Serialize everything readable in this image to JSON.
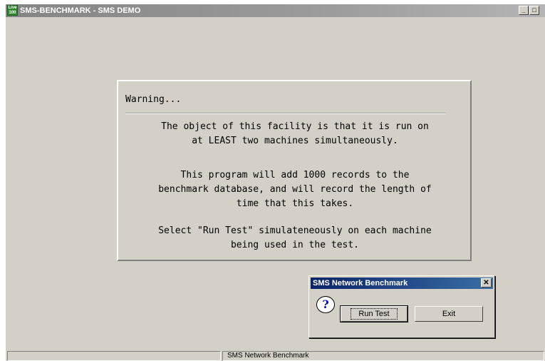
{
  "window": {
    "icon_text": "Live 100",
    "title": "SMS-BENCHMARK - SMS DEMO",
    "minimize_label": "_",
    "maximize_label": "□"
  },
  "warning": {
    "heading": "Warning...",
    "paragraphs": [
      "The object of this facility is that it is run on\nat LEAST two machines simultaneously.",
      "This program will add 1000 records to the\nbenchmark database, and will record the length of\ntime that this takes.",
      "Select \"Run Test\" simulateneously on each machine\nbeing used in the test."
    ]
  },
  "dialog": {
    "title": "SMS Network Benchmark",
    "close_label": "✕",
    "question_glyph": "?",
    "run_test_label": "Run Test",
    "exit_label": "Exit"
  },
  "statusbar": {
    "pane1": "",
    "pane2": "SMS Network Benchmark"
  }
}
